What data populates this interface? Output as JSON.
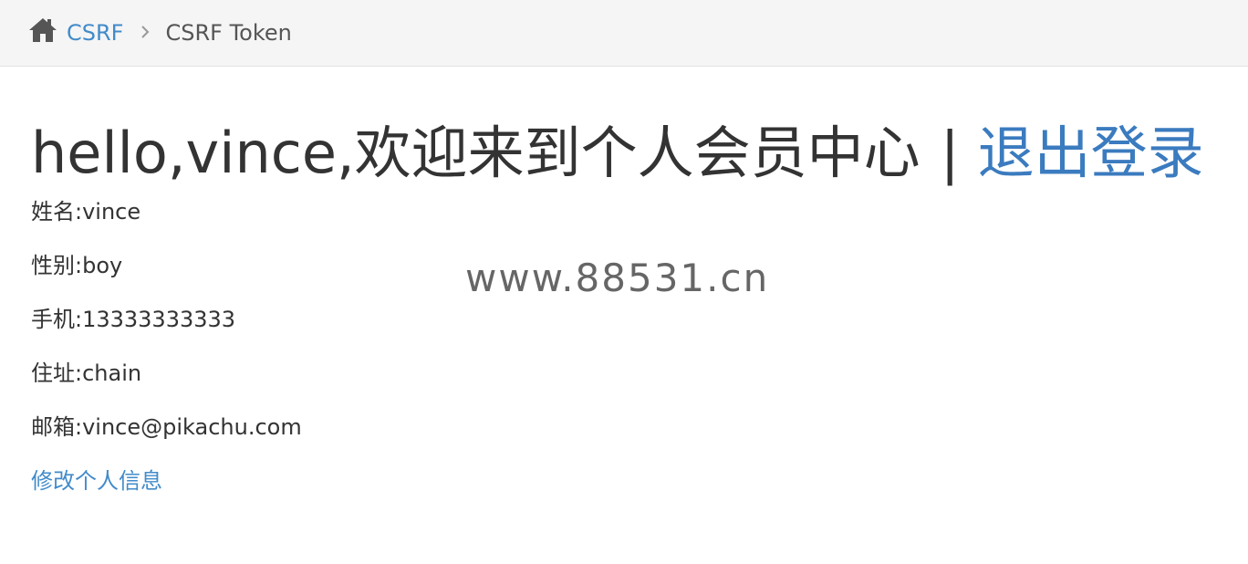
{
  "breadcrumb": {
    "home_icon": "home-icon",
    "parent_label": "CSRF",
    "current_label": "CSRF Token"
  },
  "header": {
    "greeting": "hello,vince,欢迎来到个人会员中心",
    "divider": "|",
    "logout_label": "退出登录"
  },
  "profile": {
    "name_line": "姓名:vince",
    "gender_line": "性别:boy",
    "phone_line": "手机:13333333333",
    "address_line": "住址:chain",
    "email_line": "邮箱:vince@pikachu.com",
    "edit_label": "修改个人信息"
  },
  "watermark": "www.88531.cn",
  "colors": {
    "link": "#428bca",
    "text": "#333333",
    "breadcrumb_bg": "#f5f5f5"
  }
}
